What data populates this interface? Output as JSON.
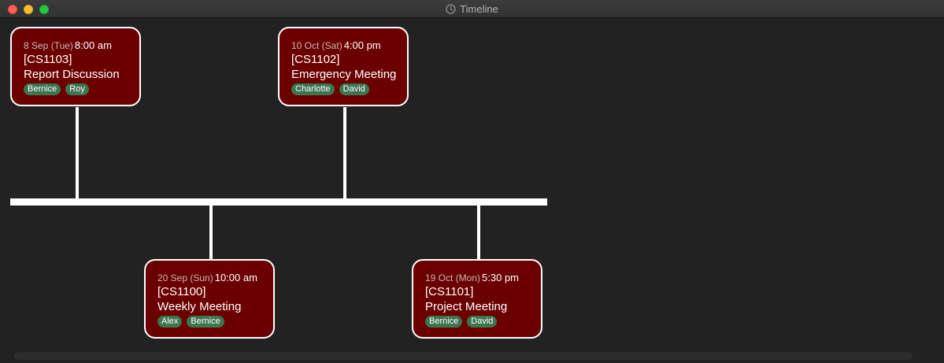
{
  "window": {
    "title": "Timeline",
    "title_icon": "clock-icon",
    "controls": [
      "close",
      "minimize",
      "zoom"
    ]
  },
  "colors": {
    "card_background": "#6b0000",
    "card_border": "#ffffff",
    "tag_background": "#3c7550",
    "axis": "#ffffff",
    "canvas_background": "#222222"
  },
  "events": [
    {
      "date": "8 Sep (Tue)",
      "time": "8:00 am",
      "code": "[CS1103]",
      "title": "Report Discussion",
      "tags": [
        "Bernice",
        "Roy"
      ],
      "side": "above"
    },
    {
      "date": "20 Sep (Sun)",
      "time": "10:00 am",
      "code": "[CS1100]",
      "title": "Weekly Meeting",
      "tags": [
        "Alex",
        "Bernice"
      ],
      "side": "below"
    },
    {
      "date": "10 Oct (Sat)",
      "time": "4:00 pm",
      "code": "[CS1102]",
      "title": "Emergency Meeting",
      "tags": [
        "Charlotte",
        "David"
      ],
      "side": "above"
    },
    {
      "date": "19 Oct (Mon)",
      "time": "5:30 pm",
      "code": "[CS1101]",
      "title": "Project Meeting",
      "tags": [
        "Bernice",
        "David"
      ],
      "side": "below"
    }
  ]
}
